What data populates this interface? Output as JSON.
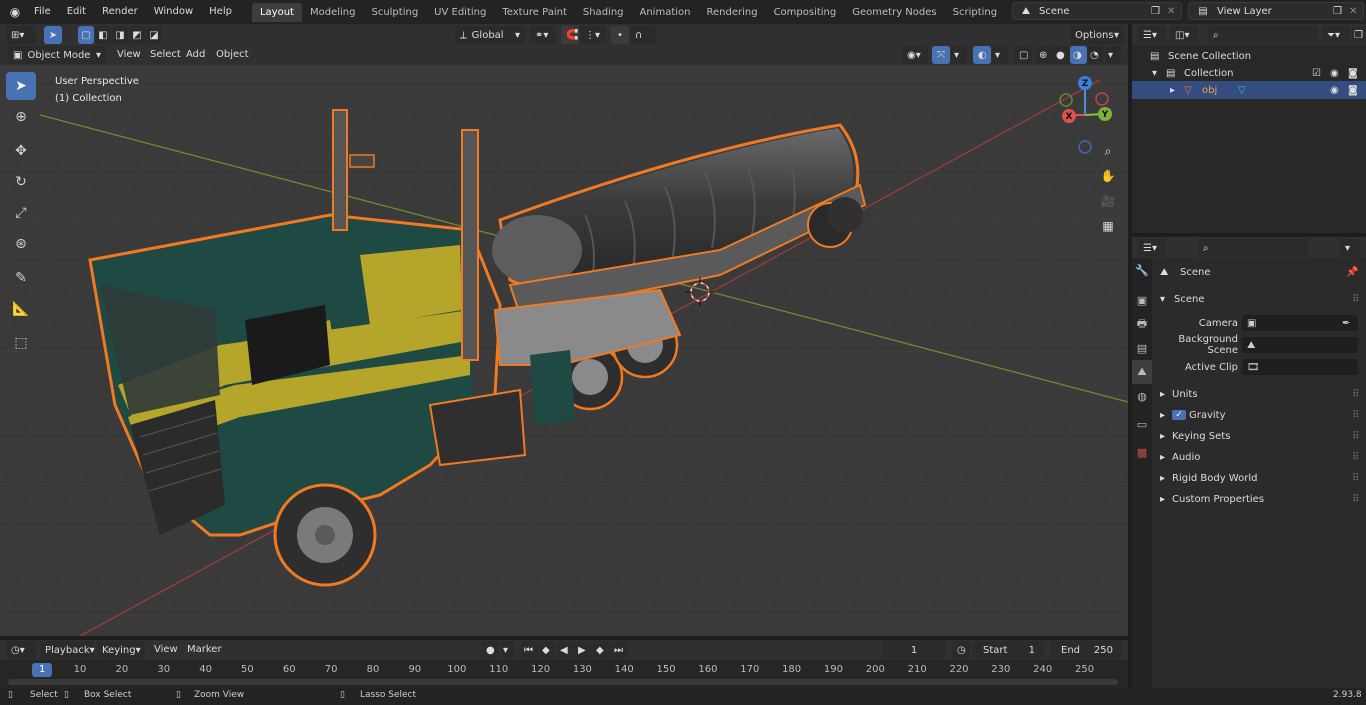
{
  "topbar": {
    "menus": [
      "File",
      "Edit",
      "Render",
      "Window",
      "Help"
    ],
    "workspaces": [
      "Layout",
      "Modeling",
      "Sculpting",
      "UV Editing",
      "Texture Paint",
      "Shading",
      "Animation",
      "Rendering",
      "Compositing",
      "Geometry Nodes",
      "Scripting"
    ],
    "active_workspace": "Layout",
    "scene": "Scene",
    "view_layer": "View Layer"
  },
  "viewport_header": {
    "transform_orientation": "Global",
    "options_label": "Options",
    "mode": "Object Mode",
    "menus": [
      "View",
      "Select",
      "Add",
      "Object"
    ]
  },
  "viewport": {
    "perspective_label": "User Perspective",
    "collection_label": "(1) Collection",
    "gizmo_axes": [
      "Z",
      "Y",
      "X"
    ]
  },
  "outliner": {
    "rows": [
      "Scene Collection",
      "Collection",
      "obj"
    ]
  },
  "properties": {
    "context": "Scene",
    "section": "Scene",
    "fields": [
      {
        "label": "Camera",
        "value": ""
      },
      {
        "label": "Background Scene",
        "value": ""
      },
      {
        "label": "Active Clip",
        "value": ""
      }
    ],
    "panels": [
      "Units",
      "Gravity",
      "Keying Sets",
      "Audio",
      "Rigid Body World",
      "Custom Properties"
    ]
  },
  "timeline": {
    "menus": [
      "Playback",
      "Keying",
      "View",
      "Marker"
    ],
    "current_frame": "1",
    "start_label": "Start",
    "start": "1",
    "end_label": "End",
    "end": "250",
    "ticks": [
      "1",
      "10",
      "20",
      "30",
      "40",
      "50",
      "60",
      "70",
      "80",
      "90",
      "100",
      "110",
      "120",
      "130",
      "140",
      "150",
      "160",
      "170",
      "180",
      "190",
      "200",
      "210",
      "220",
      "230",
      "240",
      "250"
    ]
  },
  "statusbar": {
    "items": [
      "Select",
      "Box Select",
      "Zoom View",
      "Lasso Select"
    ],
    "version": "2.93.8"
  },
  "colors": {
    "accent": "#4772b3",
    "selection_outline": "#f07a22",
    "truck_cab_green": "#1f4a43",
    "truck_stripe_yellow": "#b5a62b"
  }
}
